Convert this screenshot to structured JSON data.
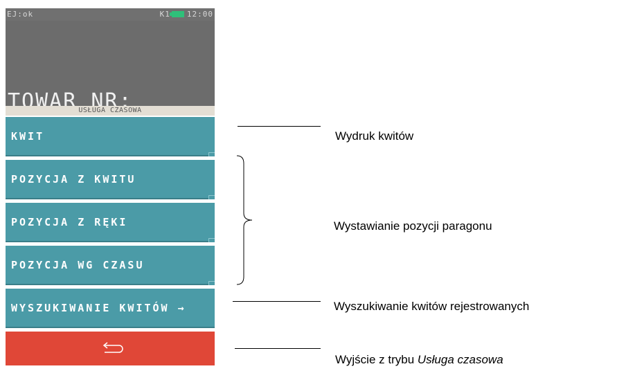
{
  "status_bar": {
    "left": "EJ:ok",
    "right_label": "K1",
    "time": "12:00",
    "battery_icon": "battery-icon"
  },
  "title": "TOWAR NR:",
  "subtitle": "USŁUGA CZASOWA",
  "menu": [
    {
      "label": "KWIT"
    },
    {
      "label": "POZYCJA Z KWITU"
    },
    {
      "label": "POZYCJA Z RĘKI"
    },
    {
      "label": "POZYCJA WG CZASU"
    },
    {
      "label": "WYSZUKIWANIE KWITÓW →"
    }
  ],
  "exit_button": {
    "icon": "back-arrow-icon",
    "color": "#e04737"
  },
  "annotations": {
    "kwit": "Wydruk kwitów",
    "pozycje": "Wystawianie pozycji paragonu",
    "wyszukiwanie": "Wyszukiwanie kwitów  rejestrowanych",
    "wyjscie_prefix": "Wyjście z trybu ",
    "wyjscie_italic": "Usługa czasowa"
  },
  "colors": {
    "accent": "#4b9ba7",
    "header": "#6c6c6c",
    "exit": "#e04737"
  }
}
